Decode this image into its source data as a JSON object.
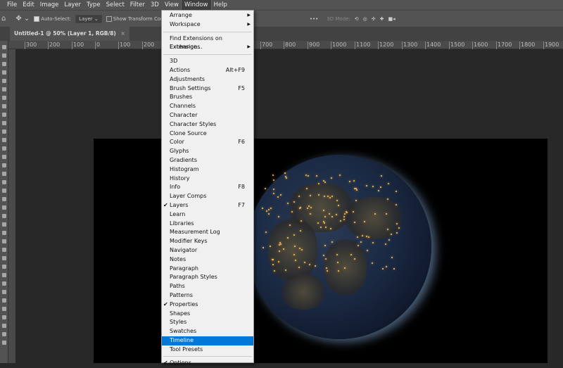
{
  "menubar": [
    "File",
    "Edit",
    "Image",
    "Layer",
    "Type",
    "Select",
    "Filter",
    "3D",
    "View",
    "Window",
    "Help"
  ],
  "options": {
    "auto_select": "Auto-Select:",
    "layer_select": "Layer",
    "show_transform": "Show Transform Controls",
    "more": "•••",
    "mode_3d": "3D Mode:"
  },
  "document_tab": {
    "title": "Untitled-1 @ 50% (Layer 1, RGB/8)",
    "close": "×"
  },
  "ruler": [
    "300",
    "200",
    "100",
    "0",
    "100",
    "200",
    "700",
    "800",
    "900",
    "1000",
    "1100",
    "1200",
    "1300",
    "1400",
    "1500",
    "1600",
    "1700",
    "1800",
    "1900"
  ],
  "window_menu": {
    "group1": [
      {
        "label": "Arrange",
        "submenu": true
      },
      {
        "label": "Workspace",
        "submenu": true
      }
    ],
    "group2": [
      {
        "label": "Find Extensions on Exchange..."
      },
      {
        "label": "Extensions",
        "submenu": true
      }
    ],
    "group3": [
      {
        "label": "3D"
      },
      {
        "label": "Actions",
        "shortcut": "Alt+F9"
      },
      {
        "label": "Adjustments"
      },
      {
        "label": "Brush Settings",
        "shortcut": "F5"
      },
      {
        "label": "Brushes"
      },
      {
        "label": "Channels"
      },
      {
        "label": "Character"
      },
      {
        "label": "Character Styles"
      },
      {
        "label": "Clone Source"
      },
      {
        "label": "Color",
        "shortcut": "F6"
      },
      {
        "label": "Glyphs"
      },
      {
        "label": "Gradients"
      },
      {
        "label": "Histogram"
      },
      {
        "label": "History"
      },
      {
        "label": "Info",
        "shortcut": "F8"
      },
      {
        "label": "Layer Comps"
      },
      {
        "label": "Layers",
        "shortcut": "F7",
        "checked": true
      },
      {
        "label": "Learn"
      },
      {
        "label": "Libraries"
      },
      {
        "label": "Measurement Log"
      },
      {
        "label": "Modifier Keys"
      },
      {
        "label": "Navigator"
      },
      {
        "label": "Notes"
      },
      {
        "label": "Paragraph"
      },
      {
        "label": "Paragraph Styles"
      },
      {
        "label": "Paths"
      },
      {
        "label": "Patterns"
      },
      {
        "label": "Properties",
        "checked": true
      },
      {
        "label": "Shapes"
      },
      {
        "label": "Styles"
      },
      {
        "label": "Swatches"
      },
      {
        "label": "Timeline",
        "highlighted": true
      },
      {
        "label": "Tool Presets"
      }
    ],
    "group4": [
      {
        "label": "Options",
        "checked": true
      }
    ]
  },
  "colors": {
    "highlight": "#0078d7",
    "ui": "#535353",
    "canvas_bg": "#282828"
  }
}
